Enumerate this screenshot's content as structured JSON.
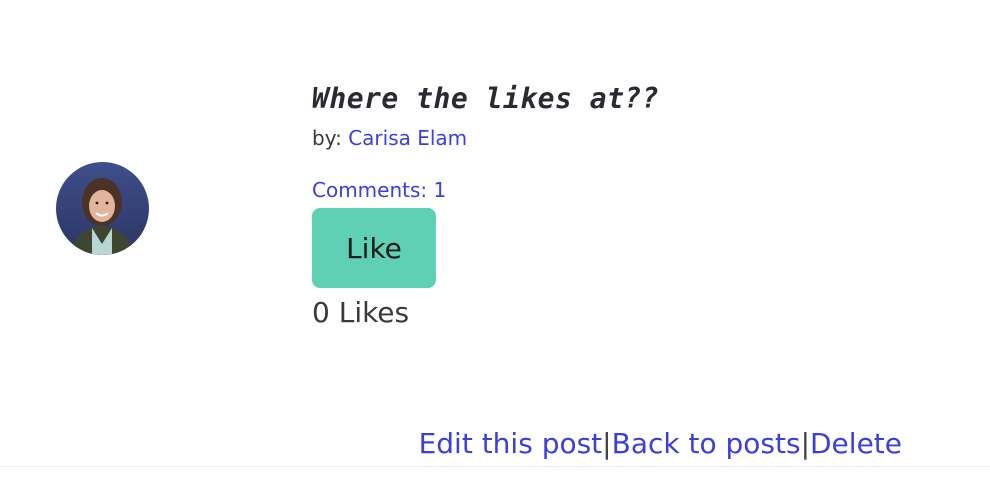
{
  "post": {
    "title": "Where the likes at??",
    "by_label": "by:",
    "author": "Carisa Elam",
    "comments_link": "Comments: 1",
    "like_button": "Like",
    "likes_count": "0 Likes"
  },
  "footer": {
    "edit": "Edit this post",
    "separator": "|",
    "back": "Back to posts",
    "delete": "Delete"
  },
  "colors": {
    "link": "#3b3fe0",
    "like_button_bg": "#5fd0b3",
    "text": "#3a3a3a"
  }
}
